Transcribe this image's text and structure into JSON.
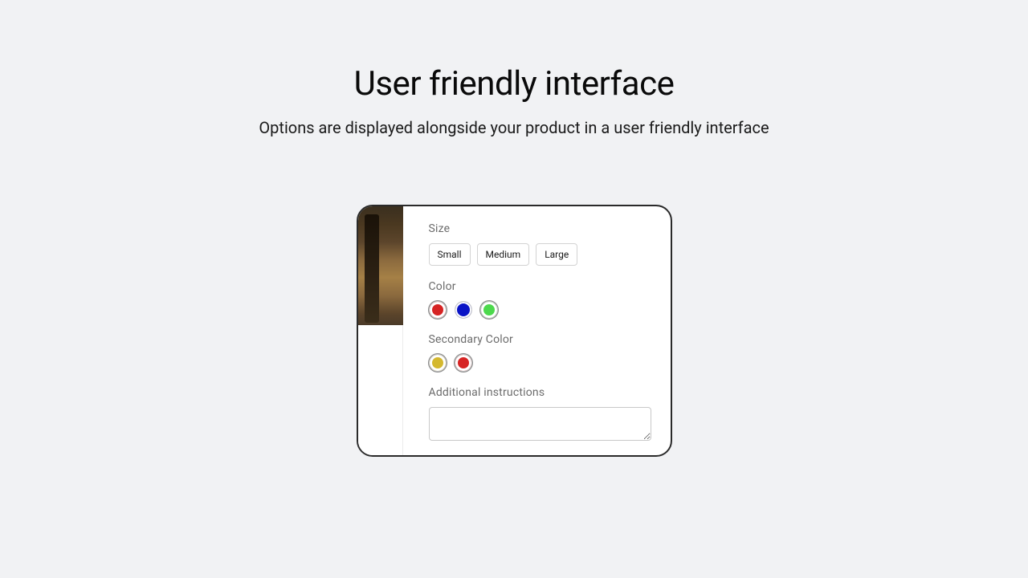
{
  "header": {
    "title": "User friendly interface",
    "subtitle": "Options are displayed alongside your product in a user friendly interface"
  },
  "card": {
    "size": {
      "label": "Size",
      "options": [
        "Small",
        "Medium",
        "Large"
      ]
    },
    "color": {
      "label": "Color",
      "swatches": [
        {
          "name": "red",
          "hex": "#d62323",
          "selected": true
        },
        {
          "name": "blue",
          "hex": "#0a14c6",
          "selected": false
        },
        {
          "name": "green",
          "hex": "#4cd94c",
          "selected": true
        }
      ]
    },
    "secondary_color": {
      "label": "Secondary Color",
      "swatches": [
        {
          "name": "gold",
          "hex": "#d4b82f",
          "selected": true
        },
        {
          "name": "red",
          "hex": "#d62323",
          "selected": true
        }
      ]
    },
    "instructions": {
      "label": "Additional instructions",
      "value": ""
    }
  }
}
